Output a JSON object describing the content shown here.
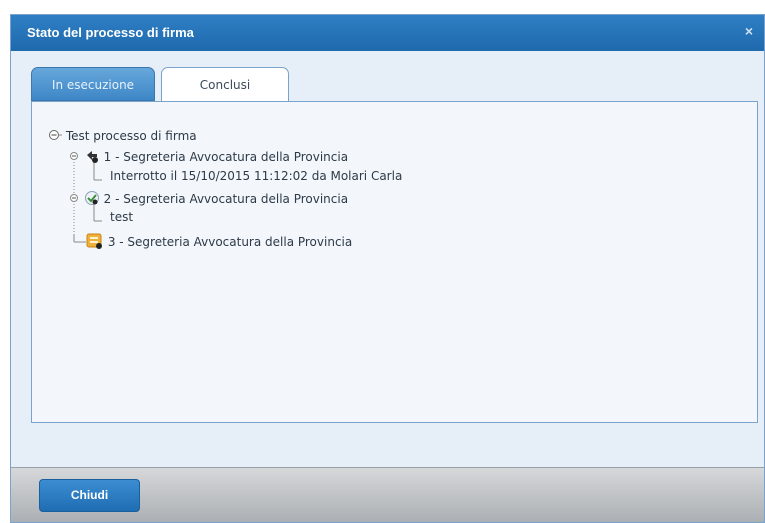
{
  "dialog": {
    "title": "Stato del processo di firma",
    "close_glyph": "×"
  },
  "tabs": [
    {
      "label": "In esecuzione",
      "active": true
    },
    {
      "label": "Conclusi",
      "active": false
    }
  ],
  "tree": {
    "root_label": "Test processo di firma",
    "steps": [
      {
        "label": "1 - Segreteria Avvocatura della Provincia",
        "icon": "interrupted-step-icon",
        "detail": "Interrotto il 15/10/2015 11:12:02 da Molari Carla"
      },
      {
        "label": "2 - Segreteria Avvocatura della Provincia",
        "icon": "completed-step-icon",
        "detail": "test"
      },
      {
        "label": "3 - Segreteria Avvocatura della Provincia",
        "icon": "pending-step-icon",
        "detail": ""
      }
    ]
  },
  "footer": {
    "close_button_label": "Chiudi"
  },
  "colors": {
    "title_bar": "#1f69ad",
    "active_tab": "#3d86c6",
    "button": "#1f6db2"
  }
}
